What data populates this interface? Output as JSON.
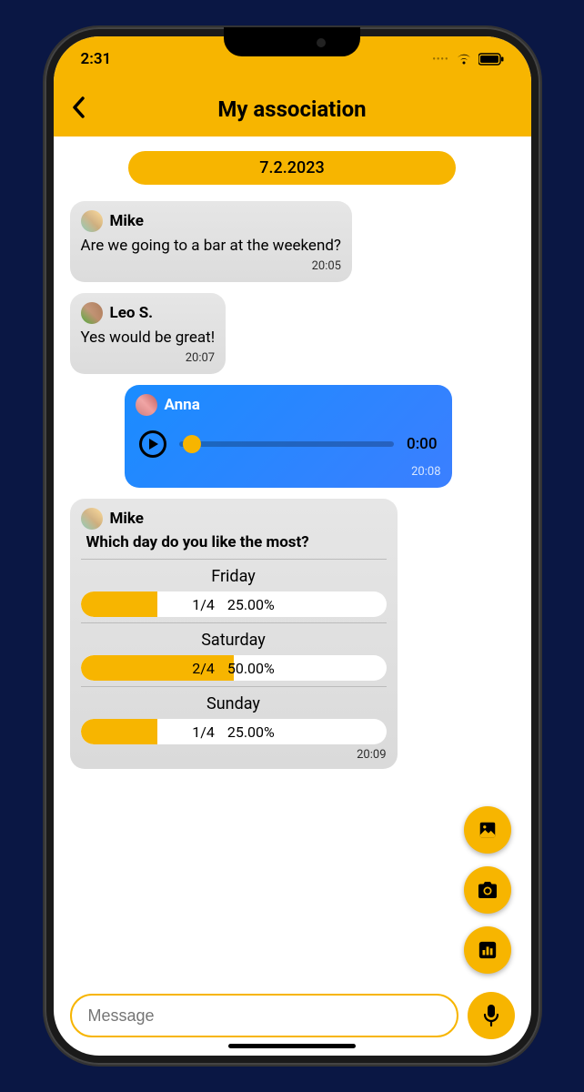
{
  "status": {
    "time": "2:31"
  },
  "header": {
    "title": "My association"
  },
  "date_separator": "7.2.2023",
  "messages": [
    {
      "sender": "Mike",
      "text": "Are we going to a bar at the weekend?",
      "time": "20:05"
    },
    {
      "sender": "Leo S.",
      "text": "Yes would be great!",
      "time": "20:07"
    }
  ],
  "voice": {
    "sender": "Anna",
    "duration": "0:00",
    "time": "20:08"
  },
  "poll": {
    "sender": "Mike",
    "question": "Which day do you like the most?",
    "time": "20:09",
    "options": [
      {
        "label": "Friday",
        "count": "1/4",
        "percent": "25.00%",
        "fill": 25
      },
      {
        "label": "Saturday",
        "count": "2/4",
        "percent": "50.00%",
        "fill": 50
      },
      {
        "label": "Sunday",
        "count": "1/4",
        "percent": "25.00%",
        "fill": 25
      }
    ]
  },
  "input": {
    "placeholder": "Message"
  }
}
